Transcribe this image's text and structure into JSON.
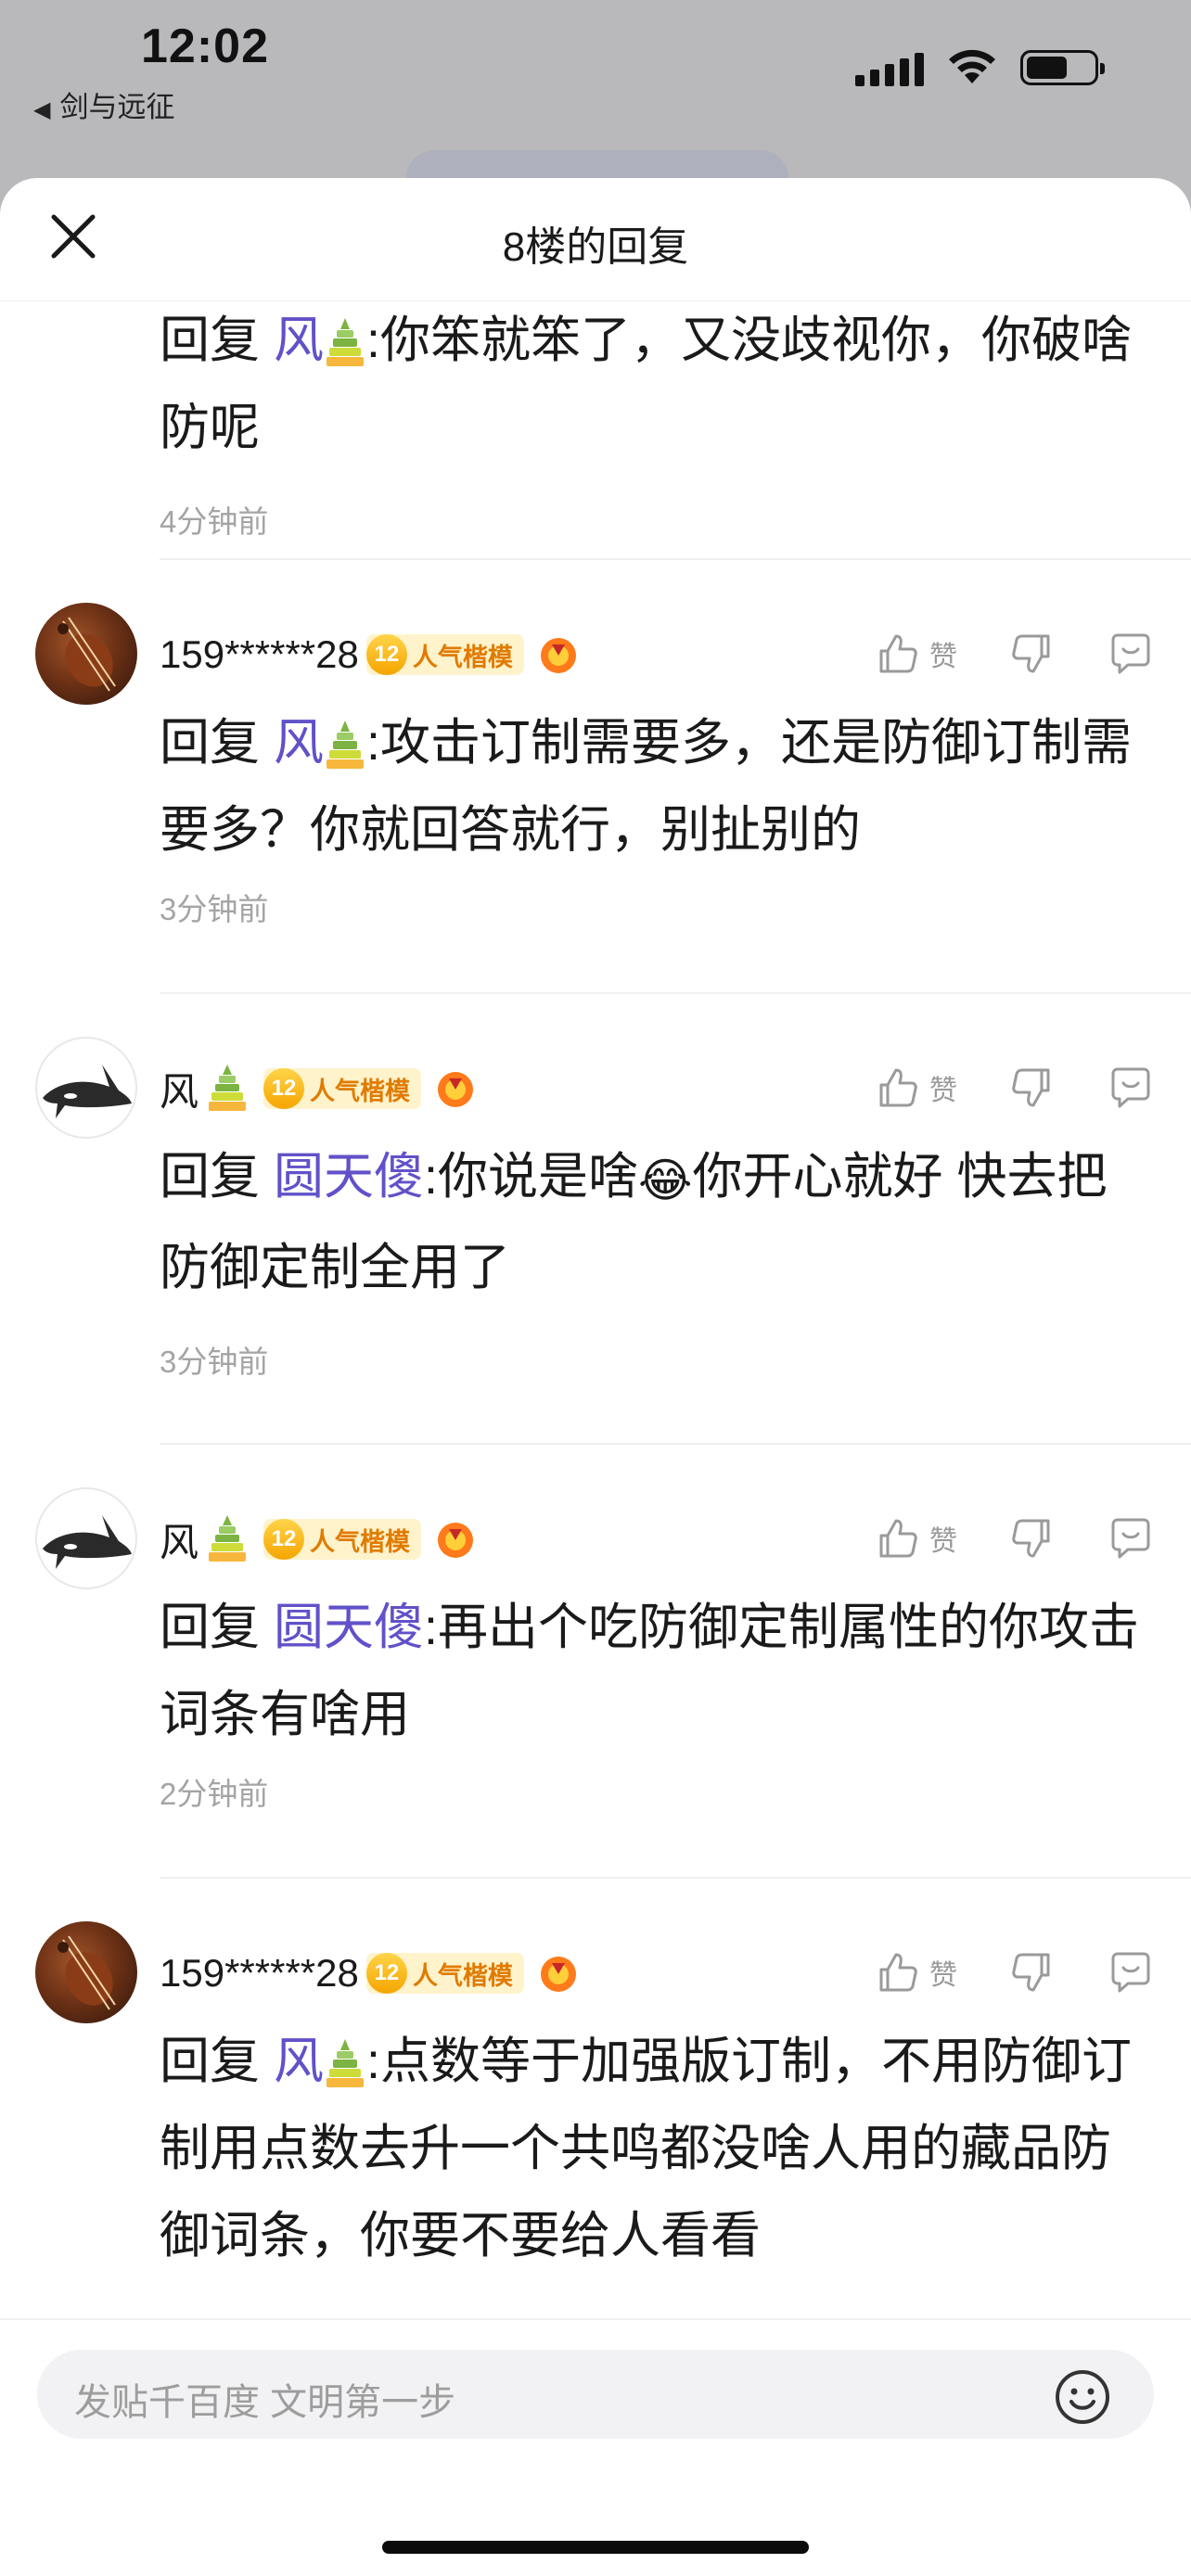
{
  "status": {
    "time": "12:02",
    "back_app": "剑与远征",
    "back_arrow": "◀"
  },
  "sheet": {
    "title": "8楼的回复",
    "close_icon": "close-icon"
  },
  "partial_comment": {
    "reply_label": "回复",
    "mention": "风",
    "text": ":你笨就笨了，又没歧视你，你破啥防呢",
    "time_ago": "4分钟前"
  },
  "comments": [
    {
      "username": "159******28",
      "level": "12",
      "level_title": "人气楷模",
      "like_label": "赞",
      "reply_label": "回复",
      "mention": "风",
      "mention_has_badge": true,
      "text": ":攻击订制需要多，还是防御订制需要多？你就回答就行，别扯别的",
      "time_ago": "3分钟前"
    },
    {
      "username": "风",
      "level": "12",
      "level_title": "人气楷模",
      "like_label": "赞",
      "reply_label": "回复",
      "mention": "圆天傻",
      "mention_has_badge": false,
      "text_before_emoji": ":你说是啥",
      "emoji": "😂",
      "text": "你开心就好 快去把防御定制全用了",
      "time_ago": "3分钟前"
    },
    {
      "username": "风",
      "level": "12",
      "level_title": "人气楷模",
      "like_label": "赞",
      "reply_label": "回复",
      "mention": "圆天傻",
      "mention_has_badge": false,
      "text": ":再出个吃防御定制属性的你攻击词条有啥用",
      "time_ago": "2分钟前"
    },
    {
      "username": "159******28",
      "level": "12",
      "level_title": "人气楷模",
      "like_label": "赞",
      "reply_label": "回复",
      "mention": "风",
      "mention_has_badge": true,
      "text": ":点数等于加强版订制，不用防御订制用点数去升一个共鸣都没啥人用的藏品防御词条，你要不要给人看看",
      "time_ago": ""
    }
  ],
  "input": {
    "placeholder": "发贴千百度 文明第一步"
  },
  "colors": {
    "mention": "#6151c9",
    "level_tag_bg": "#fff3cc",
    "level_text": "#e07b00",
    "muted": "#a4a4a4"
  }
}
